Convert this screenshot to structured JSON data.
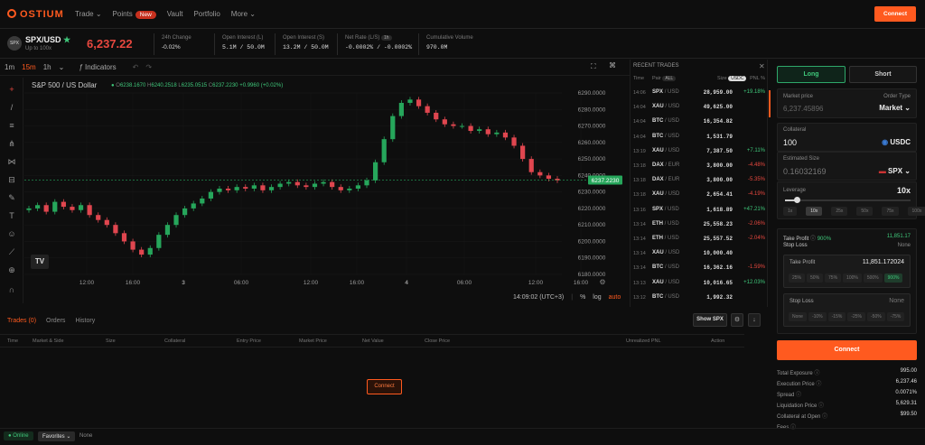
{
  "nav": {
    "logo": "OSTIUM",
    "links": [
      "Trade",
      "Points",
      "Vault",
      "Portfolio",
      "More"
    ],
    "points_badge": "New",
    "connect": "Connect"
  },
  "market": {
    "pair_icon": "SPX",
    "pair": "SPX/USD",
    "leverage_note": "Up to 100x",
    "price": "6,237.22",
    "stats": [
      {
        "label": "24h Change",
        "value": "-0.02%"
      },
      {
        "label": "Open Interest (L)",
        "value": "5.1M / 50.0M"
      },
      {
        "label": "Open Interest (S)",
        "value": "13.2M / 50.0M"
      },
      {
        "label": "Net Rate (L/S)",
        "value": "-0.0002% / -0.0002%"
      },
      {
        "label": "Cumulative Volume",
        "value": "970.0M"
      }
    ],
    "net_rate_period": "1h"
  },
  "chart_toolbar": {
    "intervals": [
      "1m",
      "15m",
      "1h"
    ],
    "active_interval": "15m",
    "indicators": "Indicators"
  },
  "chart_header": {
    "title": "S&P 500 / US Dollar",
    "o": "6238.1670",
    "h": "6240.2518",
    "l": "6235.0515",
    "c": "6237.2230",
    "change": "+0.9960 (+0.02%)"
  },
  "chart_footer": {
    "time": "14:09:02 (UTC+3)",
    "pct": "%",
    "log": "log",
    "auto": "auto"
  },
  "chart_data": {
    "type": "line",
    "title": "S&P 500 / US Dollar",
    "x": [
      "12:00",
      "16:00",
      "3",
      "06:00",
      "12:00",
      "16:00",
      "4",
      "06:00",
      "12:00",
      "16:00"
    ],
    "ylim": [
      6180,
      6290
    ],
    "yticks": [
      "6290.0000",
      "6280.0000",
      "6270.0000",
      "6260.0000",
      "6250.0000",
      "6240.0000",
      "6230.0000",
      "6220.0000",
      "6210.0000",
      "6200.0000",
      "6190.0000",
      "6180.0000"
    ],
    "series": [
      {
        "values": [
          6220,
          6222,
          6218,
          6224,
          6221,
          6219,
          6222,
          6216,
          6213,
          6210,
          6205,
          6200,
          6195,
          6192,
          6196,
          6204,
          6210,
          6216,
          6220,
          6223,
          6226,
          6230,
          6232,
          6231,
          6233,
          6232,
          6234,
          6231,
          6233,
          6235,
          6236,
          6234,
          6233,
          6235,
          6236,
          6233,
          6231,
          6232,
          6234,
          6237,
          6248,
          6262,
          6276,
          6284,
          6286,
          6282,
          6278,
          6274,
          6271,
          6270,
          6270,
          6267,
          6268,
          6265,
          6266,
          6263,
          6258,
          6250,
          6242,
          6240,
          6238,
          6237
        ]
      }
    ],
    "current_price_label": "6237.2230"
  },
  "recent_trades": {
    "title": "RECENT TRADES",
    "headers": {
      "time": "Time",
      "pair": "Pair",
      "all": "ALL",
      "size": "Size",
      "usdc": "USDC",
      "pnl": "PNL %"
    },
    "rows": [
      {
        "time": "14:06",
        "pair": "SPX",
        "quote": "/ USD",
        "size": "28,959.00",
        "pnl": "+19.18%",
        "pnl_color": "green"
      },
      {
        "time": "14:04",
        "pair": "XAU",
        "quote": "/ USD",
        "size": "49,625.00",
        "pnl": "",
        "pnl_color": ""
      },
      {
        "time": "14:04",
        "pair": "BTC",
        "quote": "/ USD",
        "size": "16,354.82",
        "pnl": "",
        "pnl_color": ""
      },
      {
        "time": "14:04",
        "pair": "BTC",
        "quote": "/ USD",
        "size": "1,531.79",
        "pnl": "",
        "pnl_color": ""
      },
      {
        "time": "13:19",
        "pair": "XAU",
        "quote": "/ USD",
        "size": "7,387.50",
        "pnl": "+7.11%",
        "pnl_color": "green"
      },
      {
        "time": "13:18",
        "pair": "DAX",
        "quote": "/ EUR",
        "size": "3,800.00",
        "pnl": "-4.48%",
        "pnl_color": "red"
      },
      {
        "time": "13:18",
        "pair": "DAX",
        "quote": "/ EUR",
        "size": "3,800.00",
        "pnl": "-5.35%",
        "pnl_color": "red"
      },
      {
        "time": "13:18",
        "pair": "XAU",
        "quote": "/ USD",
        "size": "2,654.41",
        "pnl": "-4.19%",
        "pnl_color": "red"
      },
      {
        "time": "13:16",
        "pair": "SPX",
        "quote": "/ USD",
        "size": "1,618.89",
        "pnl": "+47.21%",
        "pnl_color": "green"
      },
      {
        "time": "13:14",
        "pair": "ETH",
        "quote": "/ USD",
        "size": "25,558.23",
        "pnl": "-2.06%",
        "pnl_color": "red"
      },
      {
        "time": "13:14",
        "pair": "ETH",
        "quote": "/ USD",
        "size": "25,557.52",
        "pnl": "-2.04%",
        "pnl_color": "red"
      },
      {
        "time": "13:14",
        "pair": "XAU",
        "quote": "/ USD",
        "size": "10,000.40",
        "pnl": "",
        "pnl_color": ""
      },
      {
        "time": "13:14",
        "pair": "BTC",
        "quote": "/ USD",
        "size": "16,362.16",
        "pnl": "-1.59%",
        "pnl_color": "red"
      },
      {
        "time": "13:13",
        "pair": "XAU",
        "quote": "/ USD",
        "size": "10,016.65",
        "pnl": "+12.03%",
        "pnl_color": "green"
      },
      {
        "time": "13:12",
        "pair": "BTC",
        "quote": "/ USD",
        "size": "1,992.32",
        "pnl": "",
        "pnl_color": ""
      }
    ]
  },
  "order": {
    "long": "Long",
    "short": "Short",
    "market_price_label": "Market price",
    "market_price": "6,237.45896",
    "order_type_label": "Order Type",
    "order_type": "Market",
    "collateral_label": "Collateral",
    "collateral": "100",
    "collateral_asset": "USDC",
    "est_size_label": "Estimated Size",
    "est_size": "0.16032169",
    "est_asset": "SPX",
    "leverage_label": "Leverage",
    "leverage": "10x",
    "leverage_chips": [
      "1x",
      "10x",
      "25x",
      "50x",
      "75x",
      "100x"
    ],
    "active_leverage": "10x",
    "tp_label": "Take Profit",
    "tp_pct": "900%",
    "tp_value": "11,851.17",
    "sl_label": "Stop Loss",
    "sl_value": "None",
    "tp_box_label": "Take Profit",
    "tp_box_value": "11,851.172024",
    "tp_chips": [
      "25%",
      "50%",
      "75%",
      "100%",
      "500%",
      "900%"
    ],
    "sl_box_label": "Stop Loss",
    "sl_box_value": "None",
    "sl_chips": [
      "None",
      "-10%",
      "-15%",
      "-25%",
      "-50%",
      "-75%"
    ],
    "connect": "Connect"
  },
  "summary": [
    {
      "k": "Total Exposure",
      "v": "995.00"
    },
    {
      "k": "Execution Price",
      "v": "6,237.46"
    },
    {
      "k": "Spread",
      "v": "0.0071%"
    },
    {
      "k": "Liquidation Price",
      "v": "5,629.31"
    },
    {
      "k": "Collateral at Open",
      "v": "$99.50"
    },
    {
      "k": "Fees",
      "v": ""
    }
  ],
  "trades_panel": {
    "tabs": [
      "Trades (0)",
      "Orders",
      "History"
    ],
    "show_spx": "Show SPX",
    "headers": [
      "Time",
      "Market & Side",
      "Size",
      "Collateral",
      "Entry Price",
      "Market Price",
      "Net Value",
      "Close Price",
      "Unrealized PNL",
      "Action"
    ],
    "connect": "Connect"
  },
  "footer": {
    "online": "Online",
    "favorites": "Favorites",
    "none": "None"
  }
}
